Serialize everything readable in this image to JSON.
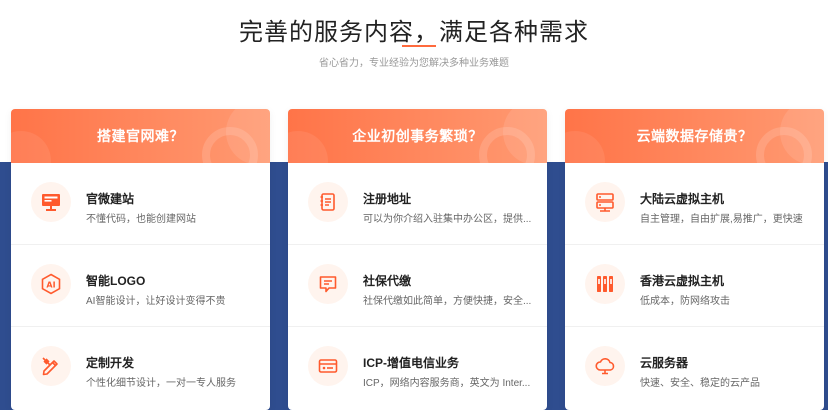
{
  "header": {
    "title": "完善的服务内容，满足各种需求",
    "subtitle": "省心省力，专业经验为您解决多种业务难题"
  },
  "colors": {
    "accent": "#ff6a3d",
    "band": "#2f4d8f",
    "icon_bg": "#fff4ee"
  },
  "cards": [
    {
      "title": "搭建官网难？",
      "items": [
        {
          "icon": "monitor-icon",
          "title": "官微建站",
          "desc": "不懂代码，也能创建网站"
        },
        {
          "icon": "ai-hexagon-icon",
          "title": "智能LOGO",
          "desc": "AI智能设计，让好设计变得不贵"
        },
        {
          "icon": "pencil-ruler-icon",
          "title": "定制开发",
          "desc": "个性化细节设计，一对一专人服务"
        }
      ]
    },
    {
      "title": "企业初创事务繁琐？",
      "items": [
        {
          "icon": "document-list-icon",
          "title": "注册地址",
          "desc": "可以为你介绍入驻集中办公区，提供..."
        },
        {
          "icon": "message-doc-icon",
          "title": "社保代缴",
          "desc": "社保代缴如此简单，方便快捷，安全..."
        },
        {
          "icon": "id-card-icon",
          "title": "ICP-增值电信业务",
          "desc": "ICP，网络内容服务商，英文为 Inter..."
        }
      ]
    },
    {
      "title": "云端数据存储贵？",
      "items": [
        {
          "icon": "server-rack-icon",
          "title": "大陆云虚拟主机",
          "desc": "自主管理，自由扩展,易推广，更快速"
        },
        {
          "icon": "server-tower-icon",
          "title": "香港云虚拟主机",
          "desc": "低成本，防网络攻击"
        },
        {
          "icon": "cloud-icon",
          "title": "云服务器",
          "desc": "快速、安全、稳定的云产品"
        }
      ]
    }
  ]
}
